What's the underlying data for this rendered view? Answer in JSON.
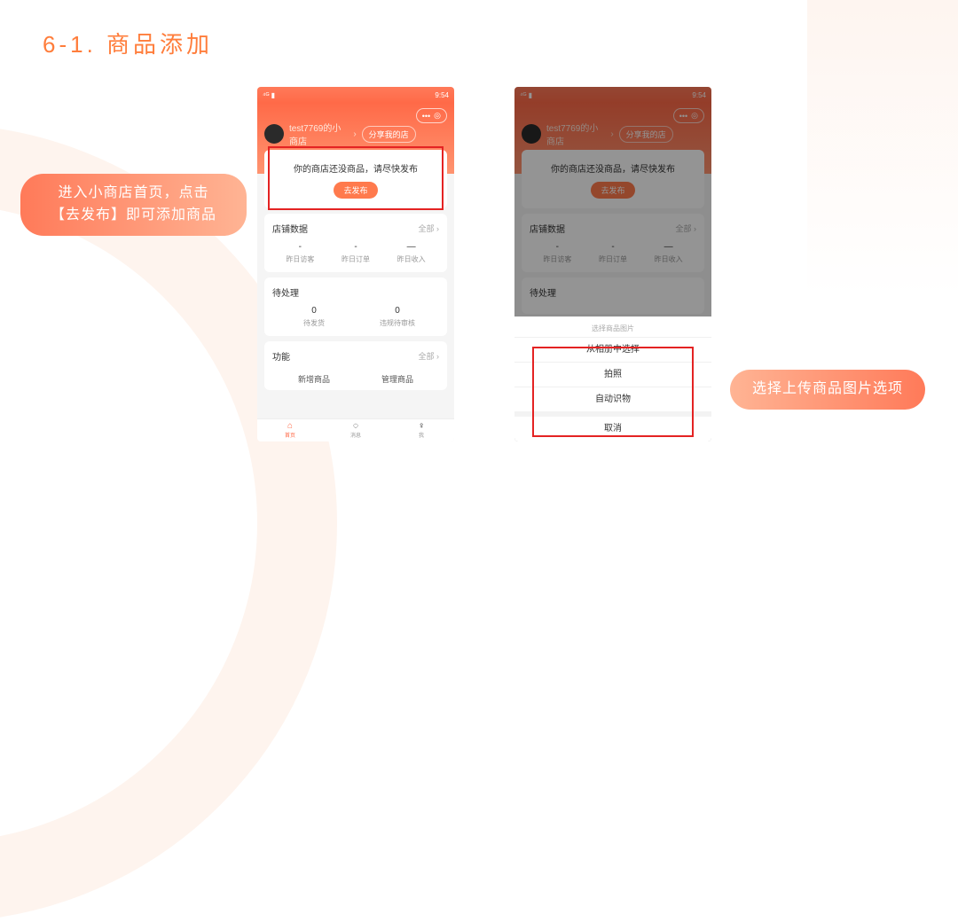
{
  "slide": {
    "title": "6-1. 商品添加"
  },
  "anno": {
    "left_line1": "进入小商店首页，点击",
    "left_line2": "【去发布】即可添加商品",
    "right": "选择上传商品图片选项"
  },
  "phone": {
    "status_time": "9:54",
    "shop_name": "test7769的小商店",
    "share": "分享我的店",
    "publish_msg": "你的商店还没商品，请尽快发布",
    "publish_btn": "去发布",
    "card_store": {
      "title": "店铺数据",
      "all": "全部 ›",
      "stats": [
        {
          "val": "-",
          "lbl": "昨日访客"
        },
        {
          "val": "-",
          "lbl": "昨日订单"
        },
        {
          "val": "—",
          "lbl": "昨日收入"
        }
      ]
    },
    "card_pending": {
      "title": "待处理",
      "stats": [
        {
          "val": "0",
          "lbl": "待发货"
        },
        {
          "val": "0",
          "lbl": "违规待审核"
        }
      ]
    },
    "card_func": {
      "title": "功能",
      "all": "全部 ›",
      "items": [
        "新增商品",
        "管理商品"
      ]
    },
    "tabs": [
      {
        "lbl": "首页",
        "ic": "⌂"
      },
      {
        "lbl": "消息",
        "ic": "◌"
      },
      {
        "lbl": "我",
        "ic": "♀"
      }
    ]
  },
  "sheet": {
    "title": "选择商品图片",
    "items": [
      "从相册中选择",
      "拍照",
      "自动识物"
    ],
    "cancel": "取消"
  }
}
